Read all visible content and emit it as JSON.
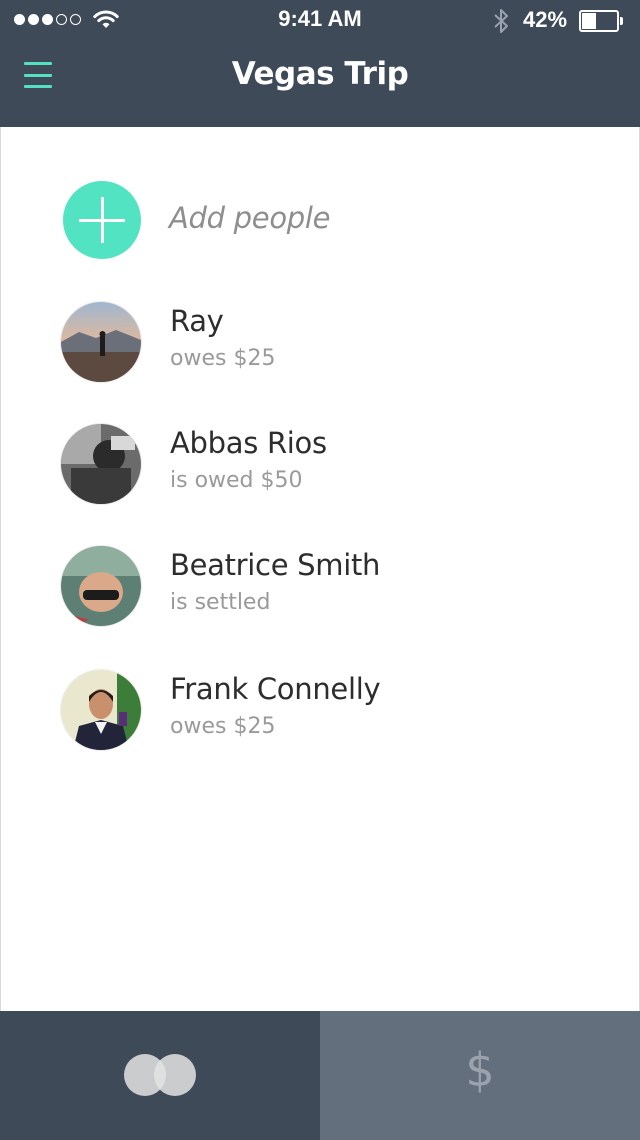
{
  "status_bar": {
    "time": "9:41 AM",
    "battery_percent": "42%",
    "battery_level": 0.42,
    "signal_bars": 3,
    "signal_total": 5,
    "icons": [
      "wifi-icon",
      "bluetooth-icon",
      "battery-icon"
    ]
  },
  "header": {
    "title": "Vegas Trip",
    "menu_icon": "hamburger-menu-icon",
    "accent_color": "#55e0bf",
    "background_color": "#3f4a58"
  },
  "add_people": {
    "label": "Add people",
    "icon": "plus-icon"
  },
  "people": [
    {
      "name": "Ray",
      "status": "owes $25"
    },
    {
      "name": "Abbas Rios",
      "status": "is owed $50"
    },
    {
      "name": "Beatrice Smith",
      "status": "is settled"
    },
    {
      "name": "Frank Connelly",
      "status": "owes $25"
    }
  ],
  "tab_bar": {
    "tabs": [
      {
        "icon": "overlapping-circles-icon",
        "active": true
      },
      {
        "icon": "dollar-icon",
        "glyph": "$",
        "active": false
      }
    ]
  }
}
